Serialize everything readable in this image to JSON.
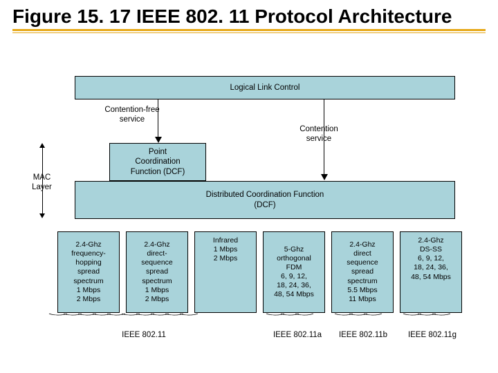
{
  "title": "Figure 15. 17 IEEE 802. 11 Protocol Architecture",
  "llc": "Logical Link Control",
  "contention_free": "Contention-free\nservice",
  "contention": "Contention\nservice",
  "pcf": "Point\nCoordination\nFunction (DCF)",
  "dcf": "Distributed Coordination Function\n(DCF)",
  "mac_layer": "MAC\nLayer",
  "phy": [
    "2.4-Ghz\nfrequency-\nhopping\nspread\nspectrum\n1 Mbps\n2 Mbps",
    "2.4-Ghz\ndirect-\nsequence\nspread\nspectrum\n1 Mbps\n2 Mbps",
    "Infrared\n1 Mbps\n2 Mbps",
    "5-Ghz\northogonal\nFDM\n6, 9, 12,\n18, 24, 36,\n48, 54 Mbps",
    "2.4-Ghz\ndirect\nsequence\nspread\nspectrum\n5.5 Mbps\n11 Mbps",
    "2.4-Ghz\nDS-SS\n6, 9, 12,\n18, 24, 36,\n48, 54 Mbps"
  ],
  "standards": [
    "IEEE 802.11",
    "IEEE 802.11a",
    "IEEE 802.11b",
    "IEEE 802.11g"
  ]
}
